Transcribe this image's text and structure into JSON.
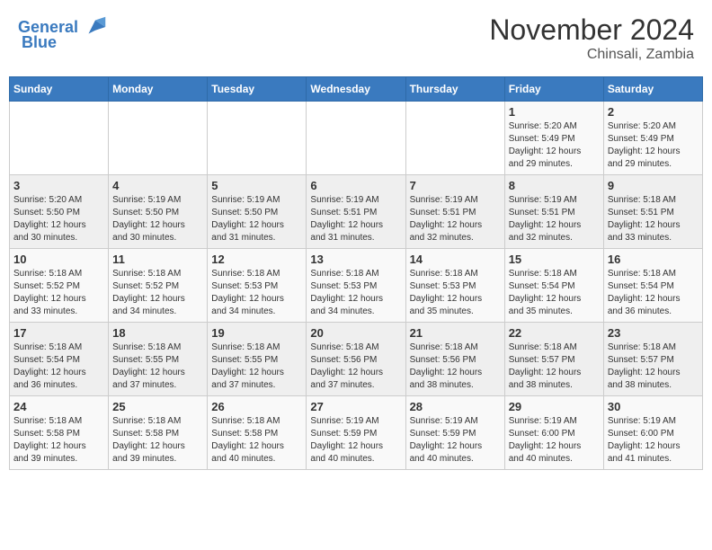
{
  "header": {
    "logo_text_general": "General",
    "logo_text_blue": "Blue",
    "title": "November 2024",
    "subtitle": "Chinsali, Zambia"
  },
  "calendar": {
    "weekdays": [
      "Sunday",
      "Monday",
      "Tuesday",
      "Wednesday",
      "Thursday",
      "Friday",
      "Saturday"
    ],
    "weeks": [
      [
        {
          "day": "",
          "info": ""
        },
        {
          "day": "",
          "info": ""
        },
        {
          "day": "",
          "info": ""
        },
        {
          "day": "",
          "info": ""
        },
        {
          "day": "",
          "info": ""
        },
        {
          "day": "1",
          "info": "Sunrise: 5:20 AM\nSunset: 5:49 PM\nDaylight: 12 hours\nand 29 minutes."
        },
        {
          "day": "2",
          "info": "Sunrise: 5:20 AM\nSunset: 5:49 PM\nDaylight: 12 hours\nand 29 minutes."
        }
      ],
      [
        {
          "day": "3",
          "info": "Sunrise: 5:20 AM\nSunset: 5:50 PM\nDaylight: 12 hours\nand 30 minutes."
        },
        {
          "day": "4",
          "info": "Sunrise: 5:19 AM\nSunset: 5:50 PM\nDaylight: 12 hours\nand 30 minutes."
        },
        {
          "day": "5",
          "info": "Sunrise: 5:19 AM\nSunset: 5:50 PM\nDaylight: 12 hours\nand 31 minutes."
        },
        {
          "day": "6",
          "info": "Sunrise: 5:19 AM\nSunset: 5:51 PM\nDaylight: 12 hours\nand 31 minutes."
        },
        {
          "day": "7",
          "info": "Sunrise: 5:19 AM\nSunset: 5:51 PM\nDaylight: 12 hours\nand 32 minutes."
        },
        {
          "day": "8",
          "info": "Sunrise: 5:19 AM\nSunset: 5:51 PM\nDaylight: 12 hours\nand 32 minutes."
        },
        {
          "day": "9",
          "info": "Sunrise: 5:18 AM\nSunset: 5:51 PM\nDaylight: 12 hours\nand 33 minutes."
        }
      ],
      [
        {
          "day": "10",
          "info": "Sunrise: 5:18 AM\nSunset: 5:52 PM\nDaylight: 12 hours\nand 33 minutes."
        },
        {
          "day": "11",
          "info": "Sunrise: 5:18 AM\nSunset: 5:52 PM\nDaylight: 12 hours\nand 34 minutes."
        },
        {
          "day": "12",
          "info": "Sunrise: 5:18 AM\nSunset: 5:53 PM\nDaylight: 12 hours\nand 34 minutes."
        },
        {
          "day": "13",
          "info": "Sunrise: 5:18 AM\nSunset: 5:53 PM\nDaylight: 12 hours\nand 34 minutes."
        },
        {
          "day": "14",
          "info": "Sunrise: 5:18 AM\nSunset: 5:53 PM\nDaylight: 12 hours\nand 35 minutes."
        },
        {
          "day": "15",
          "info": "Sunrise: 5:18 AM\nSunset: 5:54 PM\nDaylight: 12 hours\nand 35 minutes."
        },
        {
          "day": "16",
          "info": "Sunrise: 5:18 AM\nSunset: 5:54 PM\nDaylight: 12 hours\nand 36 minutes."
        }
      ],
      [
        {
          "day": "17",
          "info": "Sunrise: 5:18 AM\nSunset: 5:54 PM\nDaylight: 12 hours\nand 36 minutes."
        },
        {
          "day": "18",
          "info": "Sunrise: 5:18 AM\nSunset: 5:55 PM\nDaylight: 12 hours\nand 37 minutes."
        },
        {
          "day": "19",
          "info": "Sunrise: 5:18 AM\nSunset: 5:55 PM\nDaylight: 12 hours\nand 37 minutes."
        },
        {
          "day": "20",
          "info": "Sunrise: 5:18 AM\nSunset: 5:56 PM\nDaylight: 12 hours\nand 37 minutes."
        },
        {
          "day": "21",
          "info": "Sunrise: 5:18 AM\nSunset: 5:56 PM\nDaylight: 12 hours\nand 38 minutes."
        },
        {
          "day": "22",
          "info": "Sunrise: 5:18 AM\nSunset: 5:57 PM\nDaylight: 12 hours\nand 38 minutes."
        },
        {
          "day": "23",
          "info": "Sunrise: 5:18 AM\nSunset: 5:57 PM\nDaylight: 12 hours\nand 38 minutes."
        }
      ],
      [
        {
          "day": "24",
          "info": "Sunrise: 5:18 AM\nSunset: 5:58 PM\nDaylight: 12 hours\nand 39 minutes."
        },
        {
          "day": "25",
          "info": "Sunrise: 5:18 AM\nSunset: 5:58 PM\nDaylight: 12 hours\nand 39 minutes."
        },
        {
          "day": "26",
          "info": "Sunrise: 5:18 AM\nSunset: 5:58 PM\nDaylight: 12 hours\nand 40 minutes."
        },
        {
          "day": "27",
          "info": "Sunrise: 5:19 AM\nSunset: 5:59 PM\nDaylight: 12 hours\nand 40 minutes."
        },
        {
          "day": "28",
          "info": "Sunrise: 5:19 AM\nSunset: 5:59 PM\nDaylight: 12 hours\nand 40 minutes."
        },
        {
          "day": "29",
          "info": "Sunrise: 5:19 AM\nSunset: 6:00 PM\nDaylight: 12 hours\nand 40 minutes."
        },
        {
          "day": "30",
          "info": "Sunrise: 5:19 AM\nSunset: 6:00 PM\nDaylight: 12 hours\nand 41 minutes."
        }
      ]
    ]
  }
}
